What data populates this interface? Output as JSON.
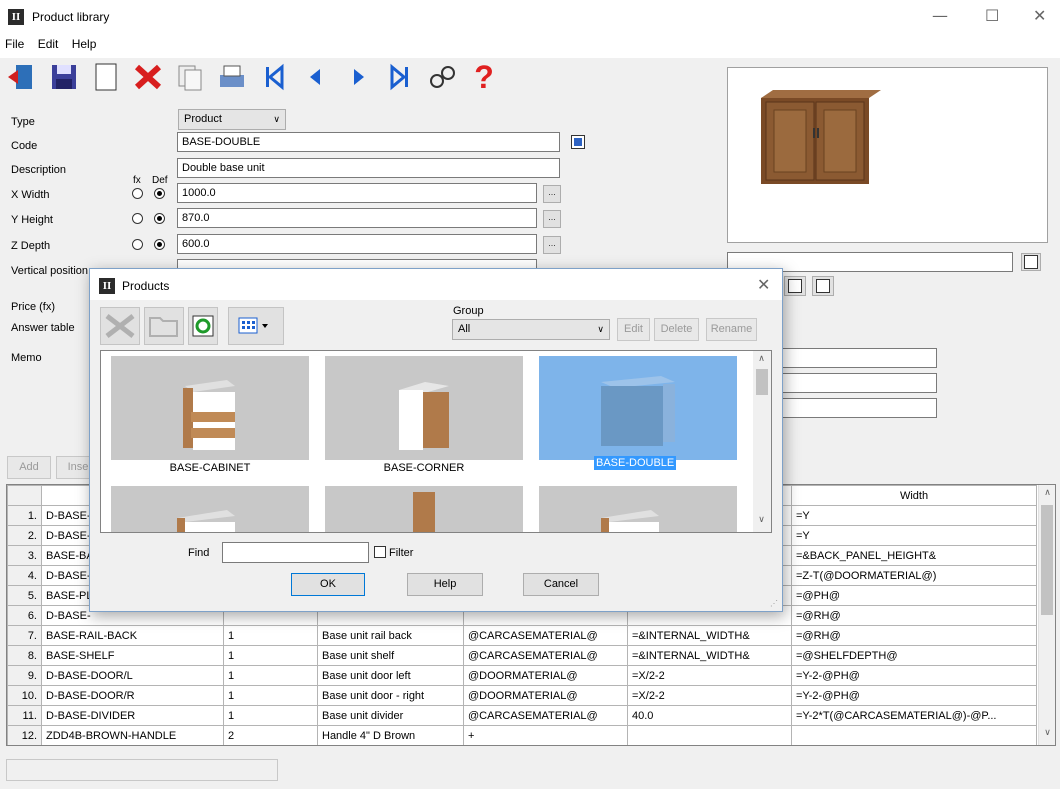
{
  "window": {
    "title": "Product library",
    "minimize": "—",
    "maximize": "☐",
    "close": "✕"
  },
  "menu": [
    "File",
    "Edit",
    "Help"
  ],
  "form": {
    "type_label": "Type",
    "type_value": "Product",
    "code_label": "Code",
    "code_value": "BASE-DOUBLE",
    "description_label": "Description",
    "description_value": "Double base unit",
    "fx_label": "fx",
    "def_label": "Def",
    "xwidth_label": "X Width",
    "xwidth_value": "1000.0",
    "yheight_label": "Y Height",
    "yheight_value": "870.0",
    "zdepth_label": "Z Depth",
    "zdepth_value": "600.0",
    "vpos_label": "Vertical position",
    "price_label": "Price (fx)",
    "answer_label": "Answer table",
    "memo_label": "Memo",
    "dots": "..."
  },
  "buttons_under_memo": {
    "add": "Add",
    "insert": "Inse"
  },
  "table": {
    "headers": [
      "",
      "",
      "",
      "",
      "",
      "",
      "Width"
    ],
    "rows": [
      [
        "1.",
        "D-BASE-",
        "",
        "",
        "",
        "",
        "=Y"
      ],
      [
        "2.",
        "D-BASE-",
        "",
        "",
        "",
        "",
        "=Y"
      ],
      [
        "3.",
        "BASE-BA",
        "",
        "",
        "",
        "",
        "=&BACK_PANEL_HEIGHT&"
      ],
      [
        "4.",
        "D-BASE-",
        "",
        "",
        "",
        "",
        "=Z-T(@DOORMATERIAL@)"
      ],
      [
        "5.",
        "BASE-PL",
        "",
        "",
        "",
        "",
        "=@PH@"
      ],
      [
        "6.",
        "D-BASE-",
        "",
        "",
        "",
        "",
        "=@RH@"
      ],
      [
        "7.",
        "BASE-RAIL-BACK",
        "1",
        "Base unit rail back",
        "@CARCASEMATERIAL@",
        "=&INTERNAL_WIDTH&",
        "=@RH@"
      ],
      [
        "8.",
        "BASE-SHELF",
        "1",
        "Base unit shelf",
        "@CARCASEMATERIAL@",
        "=&INTERNAL_WIDTH&",
        "=@SHELFDEPTH@"
      ],
      [
        "9.",
        "D-BASE-DOOR/L",
        "1",
        "Base unit door left",
        "@DOORMATERIAL@",
        "=X/2-2",
        "=Y-2-@PH@"
      ],
      [
        "10.",
        "D-BASE-DOOR/R",
        "1",
        "Base unit door - right",
        "@DOORMATERIAL@",
        "=X/2-2",
        "=Y-2-@PH@"
      ],
      [
        "11.",
        "D-BASE-DIVIDER",
        "1",
        "Base unit divider",
        "@CARCASEMATERIAL@",
        "40.0",
        "=Y-2*T(@CARCASEMATERIAL@)-@P..."
      ],
      [
        "12.",
        "ZDD4B-BROWN-HANDLE",
        "2",
        "Handle 4\" D Brown",
        "+",
        "",
        ""
      ]
    ]
  },
  "dialog": {
    "title": "Products",
    "close": "✕",
    "group_label": "Group",
    "group_value": "All",
    "edit": "Edit",
    "delete": "Delete",
    "rename": "Rename",
    "items": [
      "BASE-CABINET",
      "BASE-CORNER",
      "BASE-DOUBLE"
    ],
    "find_label": "Find",
    "filter_label": "Filter",
    "ok": "OK",
    "help": "Help",
    "cancel": "Cancel"
  },
  "colors": {
    "selection": "#3399ff",
    "thumb_bg": "#c8c8c8",
    "selected_thumb_bg": "#7eb4ea"
  }
}
